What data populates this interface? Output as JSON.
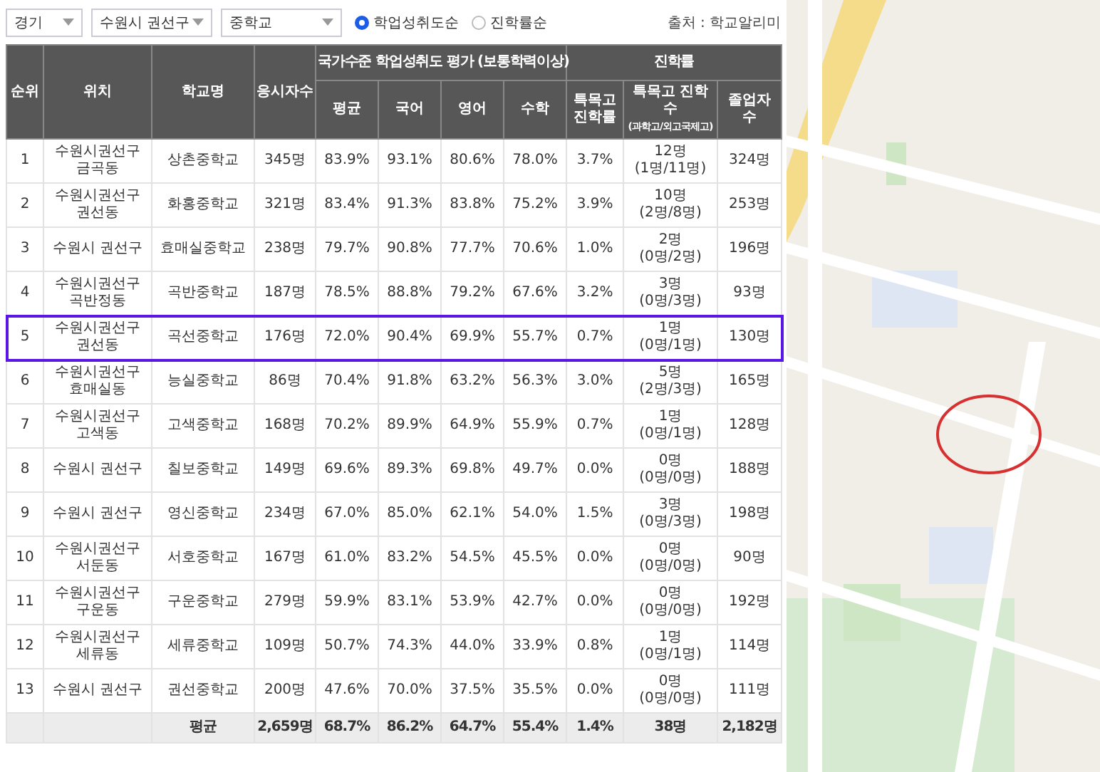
{
  "filters": {
    "dropdowns": [
      {
        "value": "경기"
      },
      {
        "value": "수원시 권선구"
      },
      {
        "value": "중학교"
      }
    ],
    "sort_options": [
      {
        "label": "학업성취도순",
        "selected": true
      },
      {
        "label": "진학률순",
        "selected": false
      }
    ],
    "source": "출처 : 학교알리미"
  },
  "table": {
    "header_groups": [
      {
        "label": "국가수준 학업성취도 평가 (보통학력이상)"
      },
      {
        "label": "진학률"
      }
    ],
    "columns": [
      {
        "label": "순위"
      },
      {
        "label": "위치"
      },
      {
        "label": "학교명"
      },
      {
        "label": "응시자수"
      },
      {
        "label": "평균"
      },
      {
        "label": "국어"
      },
      {
        "label": "영어"
      },
      {
        "label": "수학"
      },
      {
        "label": "특목고 진학률"
      },
      {
        "label": "특목고 진학수",
        "note": "(과학고/외고국제고)"
      },
      {
        "label": "졸업자 수"
      }
    ],
    "rows": [
      {
        "rank": "1",
        "location": "수원시권선구 금곡동",
        "school": "상촌중학교",
        "examinees": "345명",
        "average": "83.9%",
        "korean": "93.1%",
        "english": "80.6%",
        "math": "78.0%",
        "rate": "3.7%",
        "count": "12명",
        "breakdown": "(1명/11명)",
        "graduates": "324명",
        "selected": false
      },
      {
        "rank": "2",
        "location": "수원시권선구 권선동",
        "school": "화홍중학교",
        "examinees": "321명",
        "average": "83.4%",
        "korean": "91.3%",
        "english": "83.8%",
        "math": "75.2%",
        "rate": "3.9%",
        "count": "10명",
        "breakdown": "(2명/8명)",
        "graduates": "253명",
        "selected": false
      },
      {
        "rank": "3",
        "location": "수원시 권선구",
        "school": "효매실중학교",
        "examinees": "238명",
        "average": "79.7%",
        "korean": "90.8%",
        "english": "77.7%",
        "math": "70.6%",
        "rate": "1.0%",
        "count": "2명",
        "breakdown": "(0명/2명)",
        "graduates": "196명",
        "selected": false
      },
      {
        "rank": "4",
        "location": "수원시권선구 곡반정동",
        "school": "곡반중학교",
        "examinees": "187명",
        "average": "78.5%",
        "korean": "88.8%",
        "english": "79.2%",
        "math": "67.6%",
        "rate": "3.2%",
        "count": "3명",
        "breakdown": "(0명/3명)",
        "graduates": "93명",
        "selected": false
      },
      {
        "rank": "5",
        "location": "수원시권선구 권선동",
        "school": "곡선중학교",
        "examinees": "176명",
        "average": "72.0%",
        "korean": "90.4%",
        "english": "69.9%",
        "math": "55.7%",
        "rate": "0.7%",
        "count": "1명",
        "breakdown": "(0명/1명)",
        "graduates": "130명",
        "selected": true
      },
      {
        "rank": "6",
        "location": "수원시권선구 효매실동",
        "school": "능실중학교",
        "examinees": "86명",
        "average": "70.4%",
        "korean": "91.8%",
        "english": "63.2%",
        "math": "56.3%",
        "rate": "3.0%",
        "count": "5명",
        "breakdown": "(2명/3명)",
        "graduates": "165명",
        "selected": false
      },
      {
        "rank": "7",
        "location": "수원시권선구 고색동",
        "school": "고색중학교",
        "examinees": "168명",
        "average": "70.2%",
        "korean": "89.9%",
        "english": "64.9%",
        "math": "55.9%",
        "rate": "0.7%",
        "count": "1명",
        "breakdown": "(0명/1명)",
        "graduates": "128명",
        "selected": false
      },
      {
        "rank": "8",
        "location": "수원시 권선구",
        "school": "칠보중학교",
        "examinees": "149명",
        "average": "69.6%",
        "korean": "89.3%",
        "english": "69.8%",
        "math": "49.7%",
        "rate": "0.0%",
        "count": "0명",
        "breakdown": "(0명/0명)",
        "graduates": "188명",
        "selected": false
      },
      {
        "rank": "9",
        "location": "수원시 권선구",
        "school": "영신중학교",
        "examinees": "234명",
        "average": "67.0%",
        "korean": "85.0%",
        "english": "62.1%",
        "math": "54.0%",
        "rate": "1.5%",
        "count": "3명",
        "breakdown": "(0명/3명)",
        "graduates": "198명",
        "selected": false
      },
      {
        "rank": "10",
        "location": "수원시권선구 서둔동",
        "school": "서호중학교",
        "examinees": "167명",
        "average": "61.0%",
        "korean": "83.2%",
        "english": "54.5%",
        "math": "45.5%",
        "rate": "0.0%",
        "count": "0명",
        "breakdown": "(0명/0명)",
        "graduates": "90명",
        "selected": false
      },
      {
        "rank": "11",
        "location": "수원시권선구 구운동",
        "school": "구운중학교",
        "examinees": "279명",
        "average": "59.9%",
        "korean": "83.1%",
        "english": "53.9%",
        "math": "42.7%",
        "rate": "0.0%",
        "count": "0명",
        "breakdown": "(0명/0명)",
        "graduates": "192명",
        "selected": false
      },
      {
        "rank": "12",
        "location": "수원시권선구 세류동",
        "school": "세류중학교",
        "examinees": "109명",
        "average": "50.7%",
        "korean": "74.3%",
        "english": "44.0%",
        "math": "33.9%",
        "rate": "0.8%",
        "count": "1명",
        "breakdown": "(0명/1명)",
        "graduates": "114명",
        "selected": false
      },
      {
        "rank": "13",
        "location": "수원시 권선구",
        "school": "권선중학교",
        "examinees": "200명",
        "average": "47.6%",
        "korean": "70.0%",
        "english": "37.5%",
        "math": "35.5%",
        "rate": "0.0%",
        "count": "0명",
        "breakdown": "(0명/0명)",
        "graduates": "111명",
        "selected": false
      }
    ],
    "summary": {
      "label": "평균",
      "examinees": "2,659명",
      "average": "68.7%",
      "korean": "86.2%",
      "english": "64.7%",
      "math": "55.4%",
      "rate": "1.4%",
      "count": "38명",
      "graduates": "2,182명"
    }
  }
}
